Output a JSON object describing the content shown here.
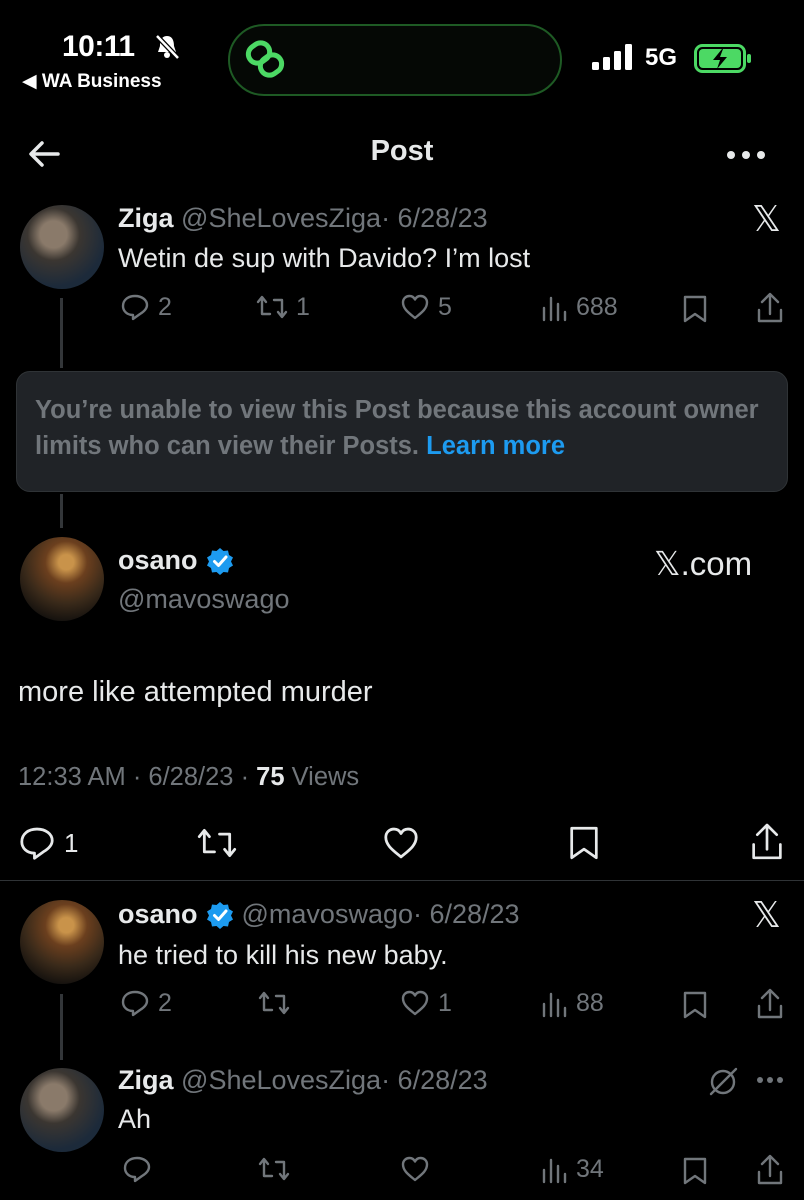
{
  "status_bar": {
    "time": "10:11",
    "back_app": "◀ WA Business",
    "network": "5G",
    "accent": "#4cd964"
  },
  "nav": {
    "title": "Post"
  },
  "tweets": [
    {
      "name": "Ziga",
      "handle": "@SheLovesZiga",
      "date": "· 6/28/23",
      "text": "Wetin de sup with Davido? I’m lost",
      "replies": "2",
      "reposts": "1",
      "likes": "5",
      "views": "688"
    }
  ],
  "restricted": {
    "text": "You’re unable to view this Post because this account owner limits who can view their Posts.",
    "link": "Learn more"
  },
  "main_post": {
    "name": "osano",
    "handle": "@mavoswago",
    "source": "𝕏.com",
    "text": "more like attempted murder",
    "time": "12:33 AM · 6/28/23 ·",
    "views_count": "75",
    "views_label": "Views",
    "replies": "1"
  },
  "replies": [
    {
      "name": "osano",
      "handle": "@mavoswago",
      "date": "· 6/28/23",
      "text": "he tried to kill his new baby.",
      "replies": "2",
      "likes": "1",
      "views": "88"
    },
    {
      "name": "Ziga",
      "handle": "@SheLovesZiga",
      "date": "· 6/28/23",
      "text": "Ah",
      "views": "34"
    }
  ],
  "colors": {
    "verified": "#1d9bf0",
    "link": "#1d9bf0",
    "muted": "#71767b"
  }
}
